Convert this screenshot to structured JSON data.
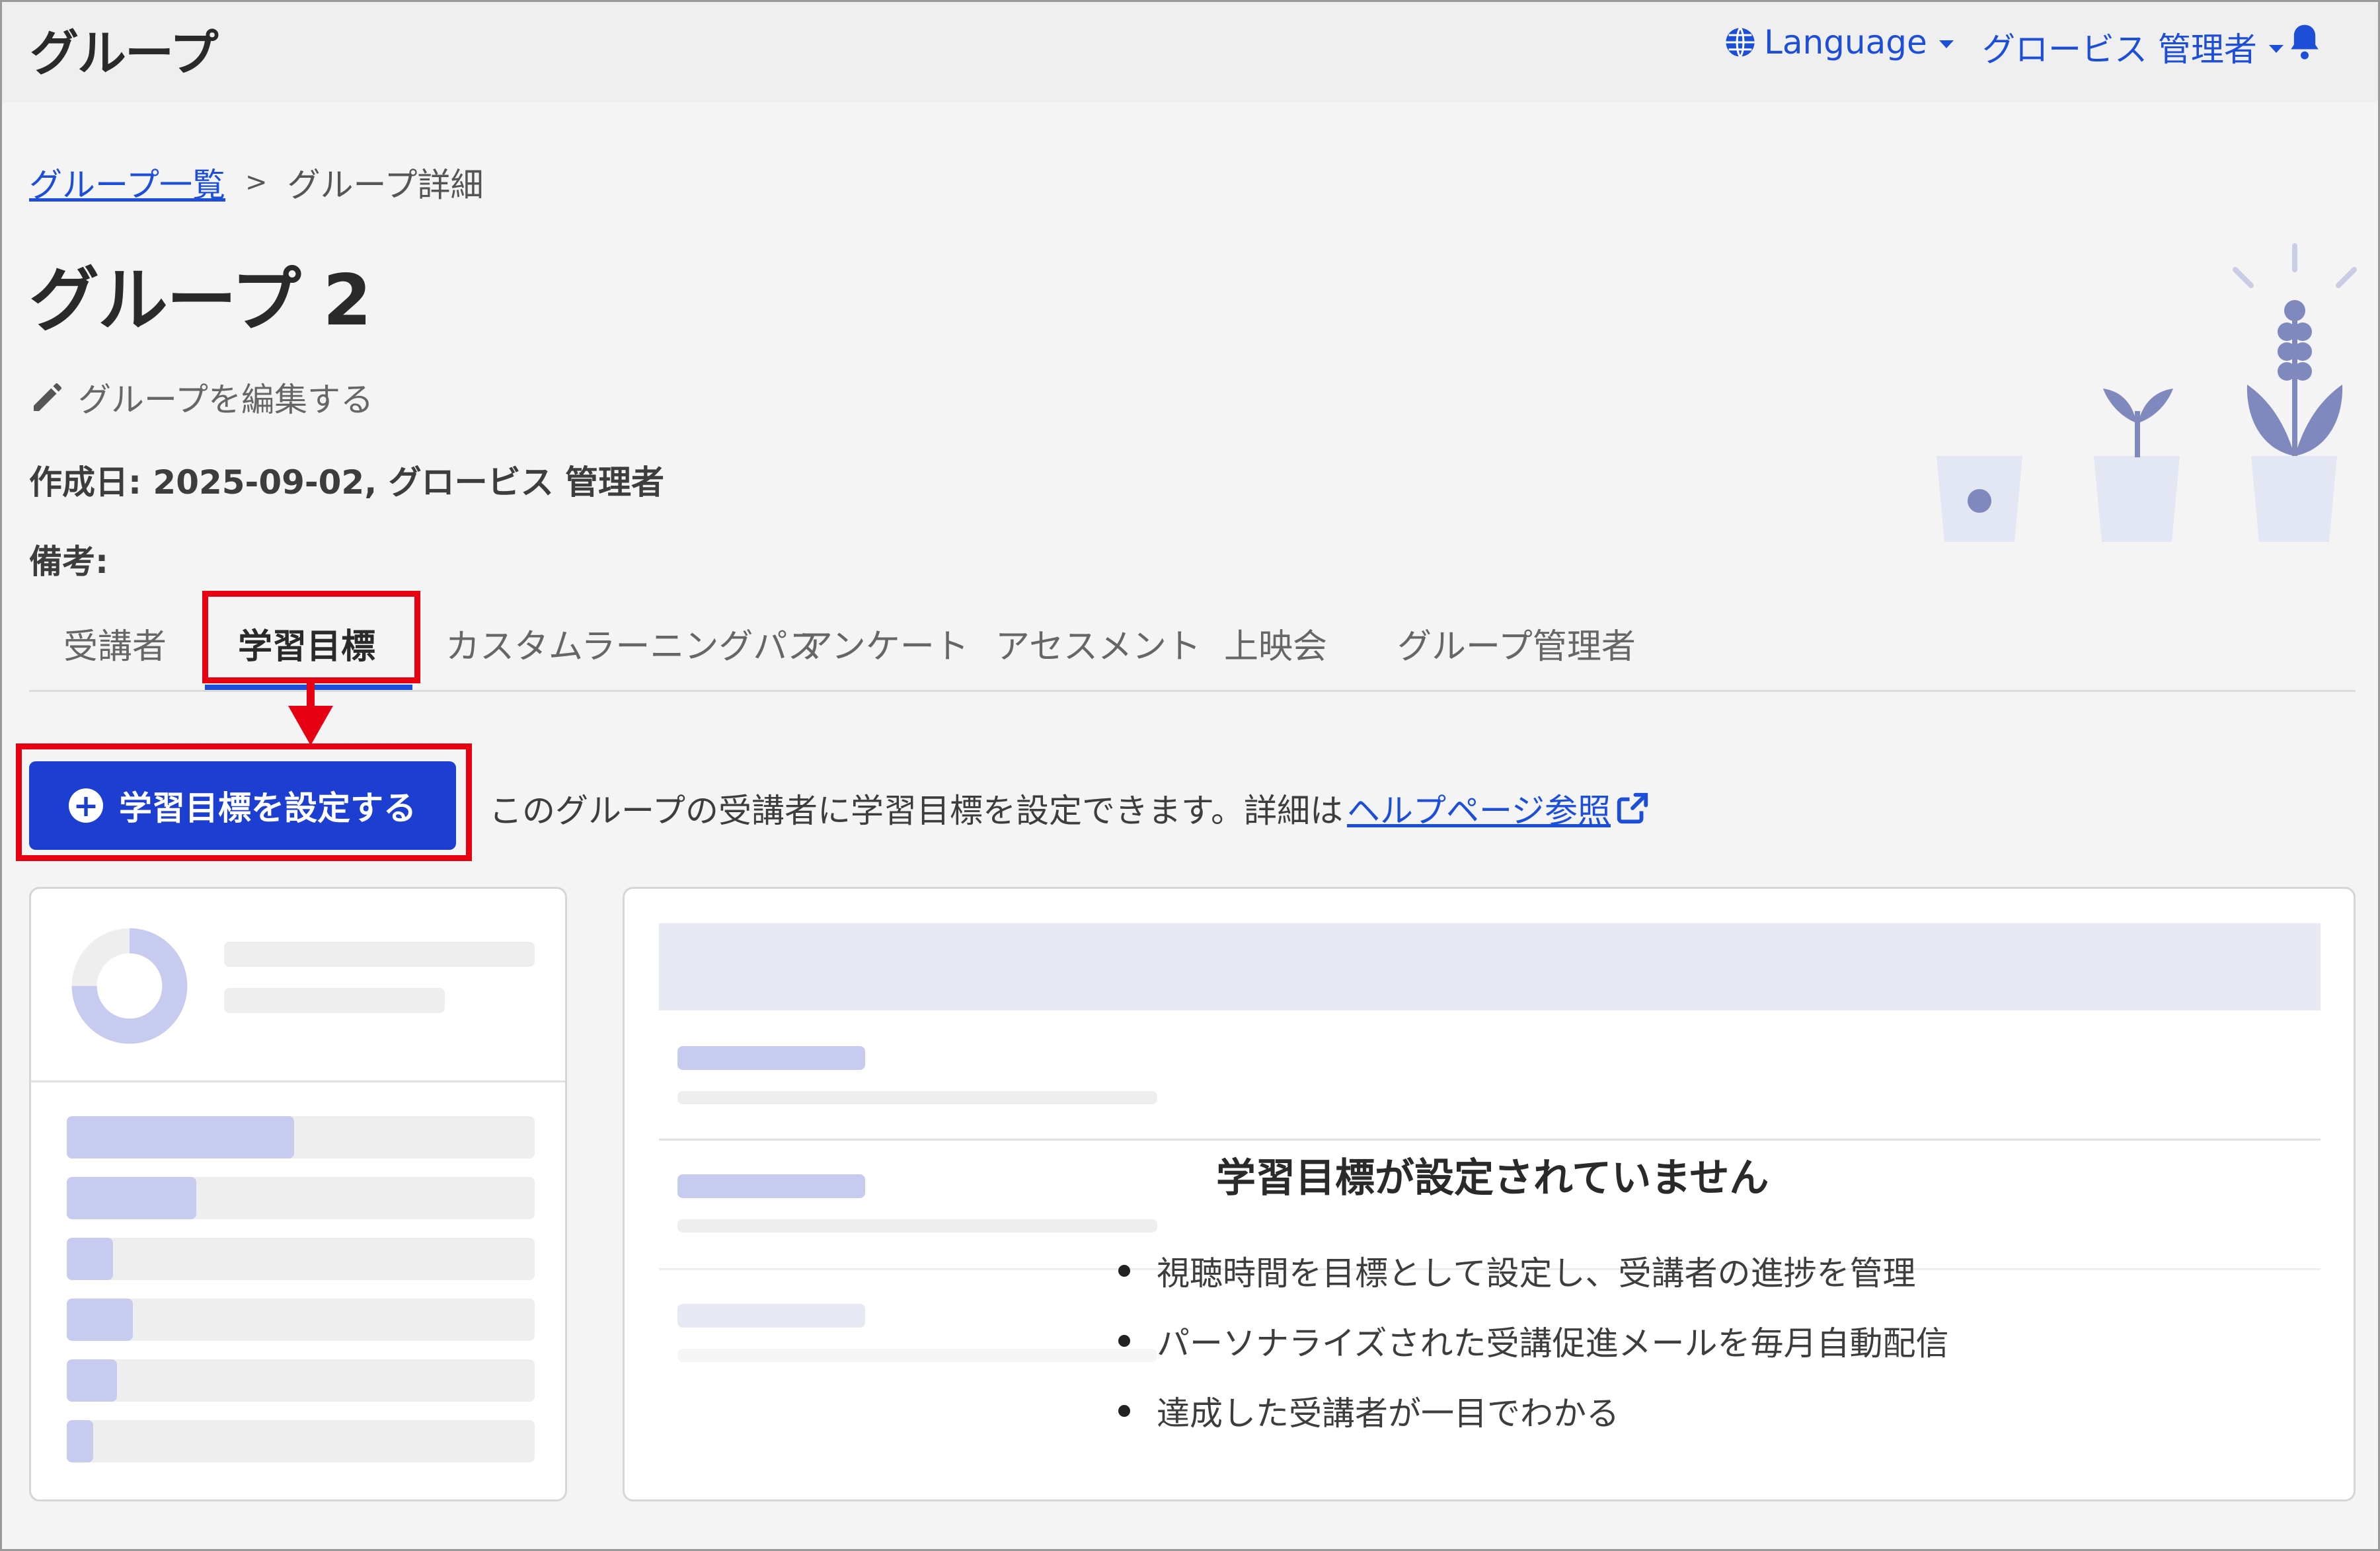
{
  "header": {
    "app_title": "グループ",
    "language_label": "Language",
    "user_label": "グロービス 管理者"
  },
  "breadcrumb": {
    "parent": "グループ一覧",
    "separator": ">",
    "current": "グループ詳細"
  },
  "group": {
    "title": "グループ 2",
    "edit_label": "グループを編集する",
    "created": "作成日: 2025-09-02, グロービス 管理者",
    "note_label": "備考:"
  },
  "tabs": [
    {
      "label": "受講者"
    },
    {
      "label": "学習目標"
    },
    {
      "label": "カスタムラーニングパス"
    },
    {
      "label": "アンケート"
    },
    {
      "label": "アセスメント"
    },
    {
      "label": "上映会"
    },
    {
      "label": "グループ管理者"
    }
  ],
  "goal": {
    "button_label": "学習目標を設定する",
    "hint_text": "このグループの受講者に学習目標を設定できます。詳細は",
    "help_link": "ヘルプページ参照",
    "empty_title": "学習目標が設定されていません",
    "bullets": [
      "視聴時間を目標として設定し、受講者の進捗を管理",
      "パーソナライズされた受講促進メールを毎月自動配信",
      "達成した受講者が一目でわかる"
    ]
  },
  "colors": {
    "primary": "#1d3fd1",
    "link": "#1d4ed8",
    "highlight": "#e60012",
    "skeleton": "#c7cbf0"
  },
  "icons": [
    "globe-icon",
    "bell-icon",
    "pencil-icon",
    "plus-circle-icon",
    "external-link-icon",
    "plants-illustration"
  ]
}
